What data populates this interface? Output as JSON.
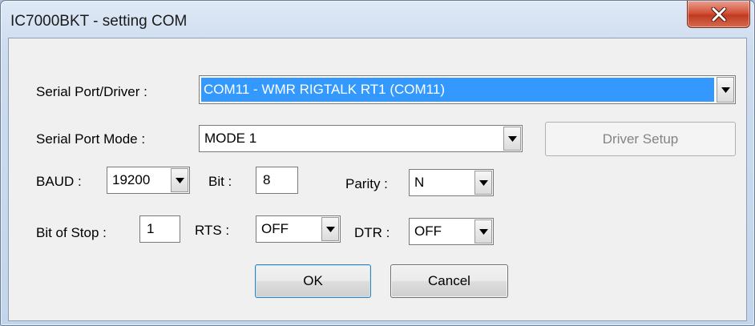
{
  "window": {
    "title": "IC7000BKT - setting COM",
    "close_glyph": "X"
  },
  "fields": {
    "serial_port_driver": {
      "label": "Serial Port/Driver :",
      "value": "COM11 - WMR RIGTALK RT1 (COM11)"
    },
    "serial_port_mode": {
      "label": "Serial Port Mode :",
      "value": "MODE 1"
    },
    "baud": {
      "label": "BAUD :",
      "value": "19200"
    },
    "bit": {
      "label": "Bit :",
      "value": "8"
    },
    "parity": {
      "label": "Parity :",
      "value": "N"
    },
    "bit_of_stop": {
      "label": "Bit of Stop :",
      "value": "1"
    },
    "rts": {
      "label": "RTS :",
      "value": "OFF"
    },
    "dtr": {
      "label": "DTR :",
      "value": "OFF"
    }
  },
  "buttons": {
    "driver_setup": "Driver Setup",
    "ok": "OK",
    "cancel": "Cancel"
  },
  "icons": {
    "close": "close-icon",
    "dropdown": "chevron-down-icon"
  },
  "colors": {
    "selection": "#3399ff",
    "close_button": "#c8442a",
    "dialog_background": "#f0f0f0"
  }
}
